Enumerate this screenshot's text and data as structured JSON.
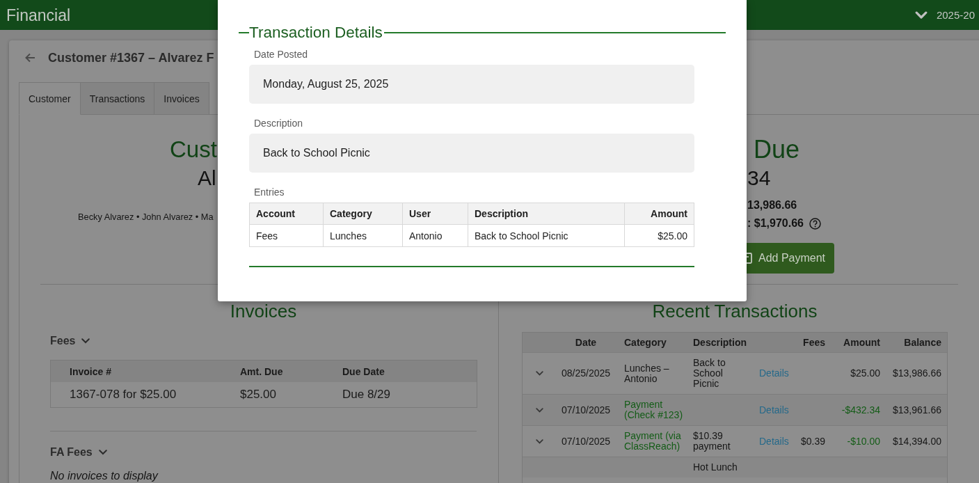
{
  "top_bar": {
    "title": "Financial",
    "year_selector": "2025-20"
  },
  "customer": {
    "title": "Customer #1367 – Alvarez F",
    "tabs": [
      {
        "label": "Customer",
        "selected": true
      },
      {
        "label": "Transactions",
        "selected": false
      },
      {
        "label": "Invoices",
        "selected": false
      }
    ]
  },
  "summary": {
    "heading": "Cust",
    "name": "Al",
    "members": "Becky Alvarez • John Alvarez • Ma"
  },
  "balance": {
    "heading": "Due",
    "amount": "34",
    "lines": [
      {
        "text": "13,986.66",
        "help": false
      },
      {
        "text": ": $1,970.66",
        "help": true
      }
    ],
    "button": "Add Payment"
  },
  "invoices": {
    "title": "Invoices",
    "groups": [
      {
        "name": "Fees",
        "columns": [
          "Invoice #",
          "Amt. Due",
          "Due Date"
        ],
        "rows": [
          [
            "1367-078 for $25.00",
            "$25.00",
            "Due 8/29"
          ]
        ]
      },
      {
        "name": "FA Fees",
        "empty_message": "No invoices to display"
      }
    ]
  },
  "recent_transactions": {
    "title": "Recent Transactions",
    "columns": [
      "Date",
      "Category",
      "Description",
      "Fees",
      "Amount",
      "Balance"
    ],
    "rows": [
      {
        "kind": "charge",
        "date": "08/25/2025",
        "category": "Lunches – Antonio",
        "description": "Back to School Picnic",
        "link": "Details",
        "amount": "$25.00",
        "balance": "$13,986.66"
      },
      {
        "kind": "payment",
        "date": "07/10/2025",
        "category": "Payment (Check #123)",
        "link": "Details",
        "amount": "-$432.34",
        "balance": "$13,961.66"
      },
      {
        "kind": "payment",
        "date": "07/10/2025",
        "category": "Payment (via ClassReach)",
        "description": "$10.39 payment",
        "link": "Details",
        "fees": "$0.39",
        "amount": "-$10.00",
        "balance": "$14,394.00"
      },
      {
        "kind": "charge",
        "description": "Hot Lunch"
      }
    ]
  },
  "dialog": {
    "title": "Transaction Details",
    "fields": [
      {
        "label": "Date Posted",
        "value": "Monday, August 25, 2025"
      },
      {
        "label": "Description",
        "value": "Back to School Picnic"
      }
    ],
    "entries": {
      "label": "Entries",
      "columns": [
        "Account",
        "Category",
        "User",
        "Description",
        "Amount"
      ],
      "rows": [
        [
          "Fees",
          "Lunches",
          "Antonio",
          "Back to School Picnic",
          "$25.00"
        ]
      ]
    }
  }
}
